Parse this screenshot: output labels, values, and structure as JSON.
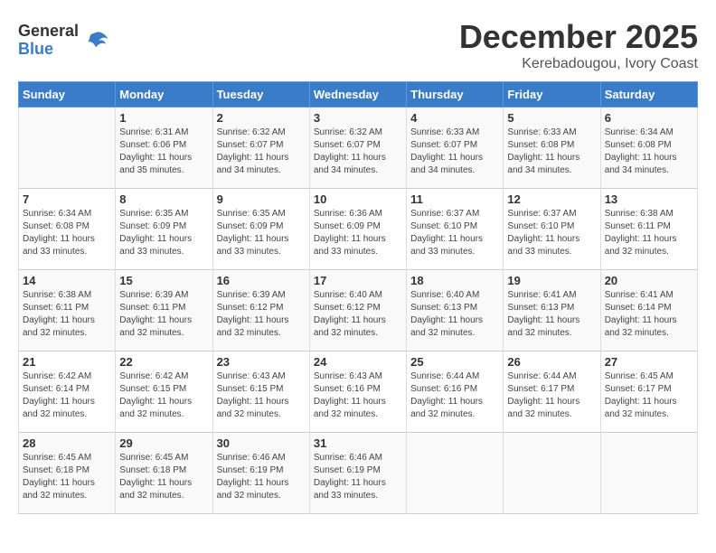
{
  "header": {
    "logo_general": "General",
    "logo_blue": "Blue",
    "month_title": "December 2025",
    "location": "Kerebadougou, Ivory Coast"
  },
  "days_of_week": [
    "Sunday",
    "Monday",
    "Tuesday",
    "Wednesday",
    "Thursday",
    "Friday",
    "Saturday"
  ],
  "weeks": [
    [
      {
        "day": "",
        "info": ""
      },
      {
        "day": "1",
        "info": "Sunrise: 6:31 AM\nSunset: 6:06 PM\nDaylight: 11 hours\nand 35 minutes."
      },
      {
        "day": "2",
        "info": "Sunrise: 6:32 AM\nSunset: 6:07 PM\nDaylight: 11 hours\nand 34 minutes."
      },
      {
        "day": "3",
        "info": "Sunrise: 6:32 AM\nSunset: 6:07 PM\nDaylight: 11 hours\nand 34 minutes."
      },
      {
        "day": "4",
        "info": "Sunrise: 6:33 AM\nSunset: 6:07 PM\nDaylight: 11 hours\nand 34 minutes."
      },
      {
        "day": "5",
        "info": "Sunrise: 6:33 AM\nSunset: 6:08 PM\nDaylight: 11 hours\nand 34 minutes."
      },
      {
        "day": "6",
        "info": "Sunrise: 6:34 AM\nSunset: 6:08 PM\nDaylight: 11 hours\nand 34 minutes."
      }
    ],
    [
      {
        "day": "7",
        "info": "Sunrise: 6:34 AM\nSunset: 6:08 PM\nDaylight: 11 hours\nand 33 minutes."
      },
      {
        "day": "8",
        "info": "Sunrise: 6:35 AM\nSunset: 6:09 PM\nDaylight: 11 hours\nand 33 minutes."
      },
      {
        "day": "9",
        "info": "Sunrise: 6:35 AM\nSunset: 6:09 PM\nDaylight: 11 hours\nand 33 minutes."
      },
      {
        "day": "10",
        "info": "Sunrise: 6:36 AM\nSunset: 6:09 PM\nDaylight: 11 hours\nand 33 minutes."
      },
      {
        "day": "11",
        "info": "Sunrise: 6:37 AM\nSunset: 6:10 PM\nDaylight: 11 hours\nand 33 minutes."
      },
      {
        "day": "12",
        "info": "Sunrise: 6:37 AM\nSunset: 6:10 PM\nDaylight: 11 hours\nand 33 minutes."
      },
      {
        "day": "13",
        "info": "Sunrise: 6:38 AM\nSunset: 6:11 PM\nDaylight: 11 hours\nand 32 minutes."
      }
    ],
    [
      {
        "day": "14",
        "info": "Sunrise: 6:38 AM\nSunset: 6:11 PM\nDaylight: 11 hours\nand 32 minutes."
      },
      {
        "day": "15",
        "info": "Sunrise: 6:39 AM\nSunset: 6:11 PM\nDaylight: 11 hours\nand 32 minutes."
      },
      {
        "day": "16",
        "info": "Sunrise: 6:39 AM\nSunset: 6:12 PM\nDaylight: 11 hours\nand 32 minutes."
      },
      {
        "day": "17",
        "info": "Sunrise: 6:40 AM\nSunset: 6:12 PM\nDaylight: 11 hours\nand 32 minutes."
      },
      {
        "day": "18",
        "info": "Sunrise: 6:40 AM\nSunset: 6:13 PM\nDaylight: 11 hours\nand 32 minutes."
      },
      {
        "day": "19",
        "info": "Sunrise: 6:41 AM\nSunset: 6:13 PM\nDaylight: 11 hours\nand 32 minutes."
      },
      {
        "day": "20",
        "info": "Sunrise: 6:41 AM\nSunset: 6:14 PM\nDaylight: 11 hours\nand 32 minutes."
      }
    ],
    [
      {
        "day": "21",
        "info": "Sunrise: 6:42 AM\nSunset: 6:14 PM\nDaylight: 11 hours\nand 32 minutes."
      },
      {
        "day": "22",
        "info": "Sunrise: 6:42 AM\nSunset: 6:15 PM\nDaylight: 11 hours\nand 32 minutes."
      },
      {
        "day": "23",
        "info": "Sunrise: 6:43 AM\nSunset: 6:15 PM\nDaylight: 11 hours\nand 32 minutes."
      },
      {
        "day": "24",
        "info": "Sunrise: 6:43 AM\nSunset: 6:16 PM\nDaylight: 11 hours\nand 32 minutes."
      },
      {
        "day": "25",
        "info": "Sunrise: 6:44 AM\nSunset: 6:16 PM\nDaylight: 11 hours\nand 32 minutes."
      },
      {
        "day": "26",
        "info": "Sunrise: 6:44 AM\nSunset: 6:17 PM\nDaylight: 11 hours\nand 32 minutes."
      },
      {
        "day": "27",
        "info": "Sunrise: 6:45 AM\nSunset: 6:17 PM\nDaylight: 11 hours\nand 32 minutes."
      }
    ],
    [
      {
        "day": "28",
        "info": "Sunrise: 6:45 AM\nSunset: 6:18 PM\nDaylight: 11 hours\nand 32 minutes."
      },
      {
        "day": "29",
        "info": "Sunrise: 6:45 AM\nSunset: 6:18 PM\nDaylight: 11 hours\nand 32 minutes."
      },
      {
        "day": "30",
        "info": "Sunrise: 6:46 AM\nSunset: 6:19 PM\nDaylight: 11 hours\nand 32 minutes."
      },
      {
        "day": "31",
        "info": "Sunrise: 6:46 AM\nSunset: 6:19 PM\nDaylight: 11 hours\nand 33 minutes."
      },
      {
        "day": "",
        "info": ""
      },
      {
        "day": "",
        "info": ""
      },
      {
        "day": "",
        "info": ""
      }
    ]
  ]
}
